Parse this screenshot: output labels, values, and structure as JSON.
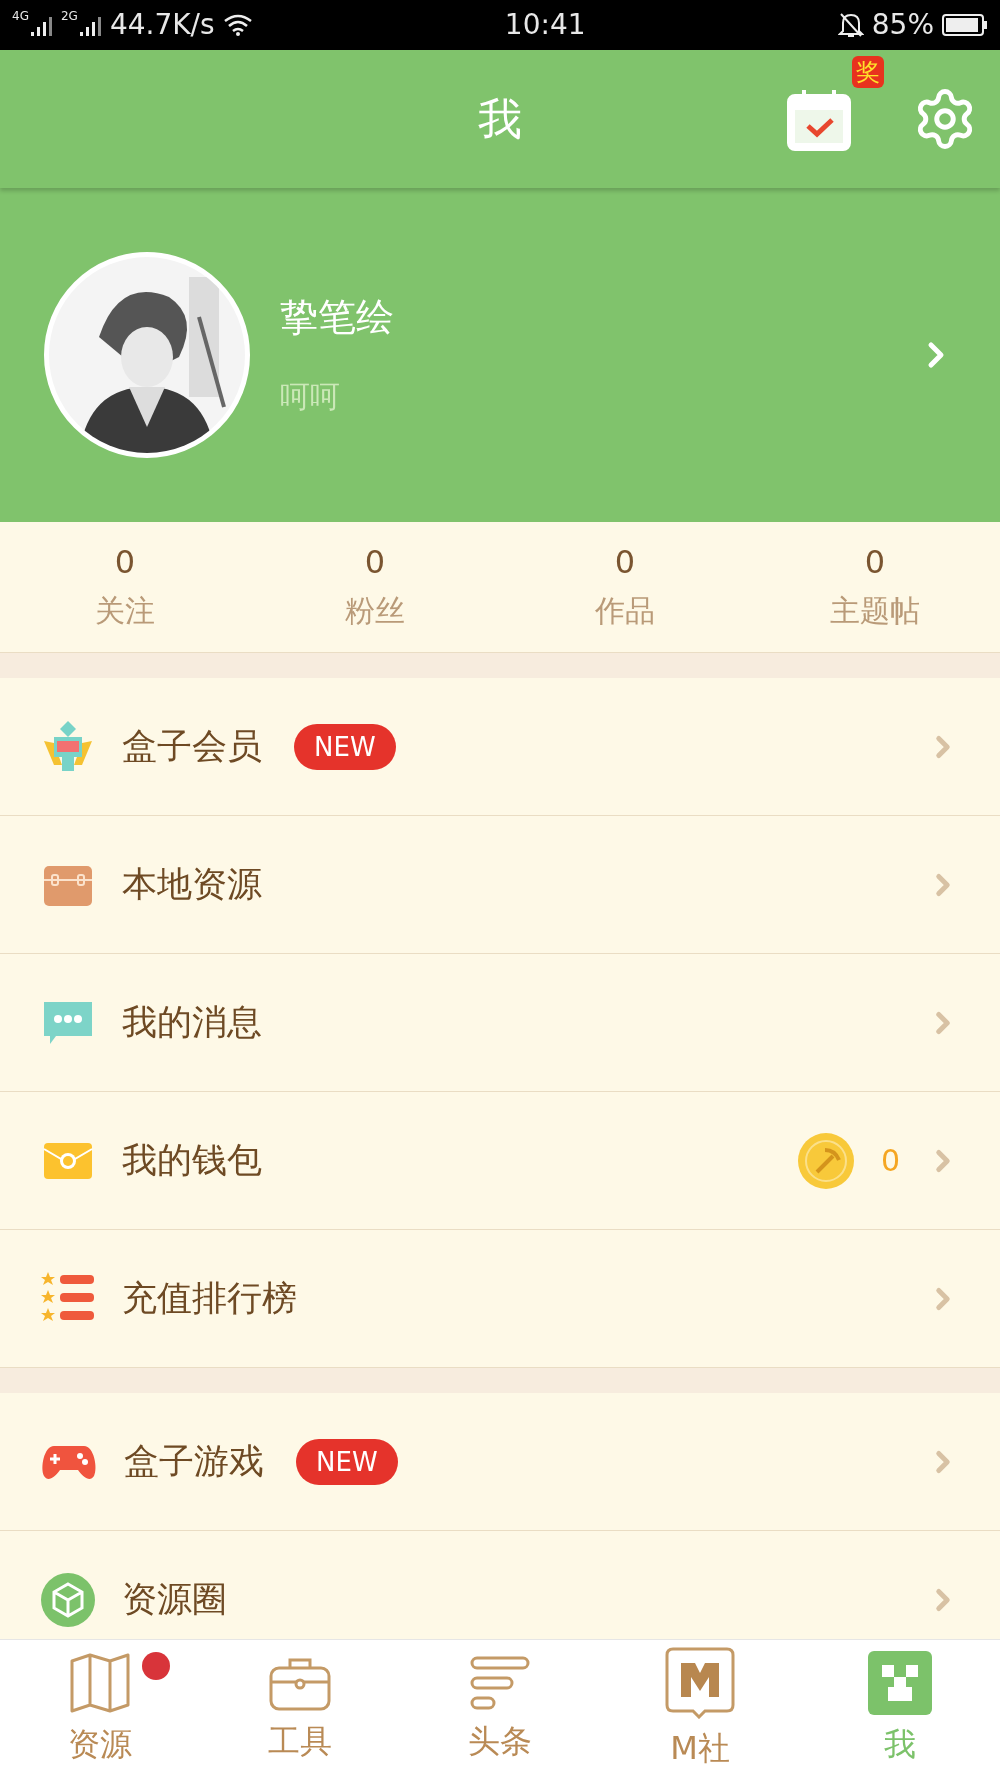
{
  "status_bar": {
    "network_1": "4G",
    "network_2": "2G",
    "speed": "44.7K/s",
    "time": "10:41",
    "battery": "85%"
  },
  "header": {
    "title": "我",
    "reward_badge": "奖"
  },
  "profile": {
    "name": "挚笔绘",
    "bio": "呵呵"
  },
  "stats": [
    {
      "value": "0",
      "label": "关注"
    },
    {
      "value": "0",
      "label": "粉丝"
    },
    {
      "value": "0",
      "label": "作品"
    },
    {
      "value": "0",
      "label": "主题帖"
    }
  ],
  "menu_sections": [
    [
      {
        "label": "盒子会员",
        "badge": "NEW"
      },
      {
        "label": "本地资源"
      },
      {
        "label": "我的消息"
      },
      {
        "label": "我的钱包",
        "value": "0"
      },
      {
        "label": "充值排行榜"
      }
    ],
    [
      {
        "label": "盒子游戏",
        "badge": "NEW"
      },
      {
        "label": "资源圈"
      }
    ]
  ],
  "nav": [
    {
      "label": "资源",
      "selected": false,
      "dot": true
    },
    {
      "label": "工具",
      "selected": false,
      "dot": false
    },
    {
      "label": "头条",
      "selected": false,
      "dot": false
    },
    {
      "label": "M社",
      "selected": false,
      "dot": false
    },
    {
      "label": "我",
      "selected": true,
      "dot": false
    }
  ]
}
